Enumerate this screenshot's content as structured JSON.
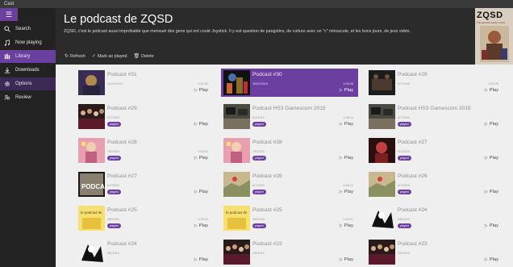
{
  "window": {
    "title": "Cast"
  },
  "sidebar": {
    "items": [
      {
        "label": "Search",
        "icon": "search-icon"
      },
      {
        "label": "Now playing",
        "icon": "music-note-icon"
      },
      {
        "label": "Library",
        "icon": "library-icon",
        "active": true
      },
      {
        "label": "Downloads",
        "icon": "download-icon"
      },
      {
        "label": "Options",
        "icon": "gear-icon"
      },
      {
        "label": "Review",
        "icon": "people-icon"
      }
    ]
  },
  "header": {
    "title": "Le podcast de ZQSD",
    "description": "ZQSD, c'est le podcast aussi improbable que mensuel des gens qui ont coulé Joystick. Il y est question de pangolins, de culture avec un \"c\" minuscule, et les bons jours, de jeux vidéo.",
    "cover_text": "ZQSD",
    "cover_tagline": "The genuine wacky sound"
  },
  "toolbar": {
    "refresh": "Refresh",
    "mark_played": "Mark as played",
    "delete": "Delete"
  },
  "episodes": [
    {
      "title": "Podcast #31",
      "date": "11/20/2015",
      "duration": "2:01:52",
      "badge": "",
      "play": "Play",
      "thumb": "purple"
    },
    {
      "title": "Podcast #30",
      "date": "10/20/2015",
      "duration": "2:06:26",
      "badge": "",
      "play": "Play",
      "thumb": "dark-scene",
      "selected": true
    },
    {
      "title": "Podcast #29",
      "date": "9/7/2015",
      "duration": "1:57:46",
      "badge": "",
      "play": "Play",
      "thumb": "dark-room"
    },
    {
      "title": "Podcast #29",
      "date": "9/7/2015",
      "duration": "",
      "badge": "played",
      "play": "Play",
      "thumb": "crowd"
    },
    {
      "title": "Podcast HS3 Gamescom 2015",
      "date": "8/7/2015",
      "duration": "1:08:11",
      "badge": "played",
      "play": "Play",
      "thumb": "desk"
    },
    {
      "title": "Podcast HS3 Gamescom 2015",
      "date": "8/7/2015",
      "duration": "",
      "badge": "played",
      "play": "Play",
      "thumb": "desk"
    },
    {
      "title": "Podcast #28",
      "date": "7/6/2015",
      "duration": "2:02:34",
      "badge": "played",
      "play": "Play",
      "thumb": "pink"
    },
    {
      "title": "Podcast #28",
      "date": "7/6/2015",
      "duration": "",
      "badge": "played",
      "play": "Play",
      "thumb": "pink"
    },
    {
      "title": "Podcast #27",
      "date": "6/7/2015",
      "duration": "",
      "badge": "played",
      "play": "Play",
      "thumb": "red"
    },
    {
      "title": "Podcast #27",
      "date": "6/7/2015",
      "duration": "",
      "badge": "played",
      "play": "Play",
      "thumb": "poster"
    },
    {
      "title": "Podcast #26",
      "date": "5/7/2015",
      "duration": "1:58:12",
      "badge": "played",
      "play": "Play",
      "thumb": "map"
    },
    {
      "title": "Podcast #26",
      "date": "5/7/2015",
      "duration": "",
      "badge": "played",
      "play": "Play",
      "thumb": "map"
    },
    {
      "title": "Podcast #25",
      "date": "4/5/2015",
      "duration": "2:26:31",
      "badge": "played",
      "play": "Play",
      "thumb": "yellow"
    },
    {
      "title": "Podcast #25",
      "date": "4/5/2015",
      "duration": "2:26:31",
      "badge": "played",
      "play": "Play",
      "thumb": "yellow"
    },
    {
      "title": "Podcast #24",
      "date": "3/5/2015",
      "duration": "",
      "badge": "played",
      "play": "Play",
      "thumb": "bw"
    },
    {
      "title": "Podcast #24",
      "date": "3/5/2015",
      "duration": "",
      "badge": "",
      "play": "Play",
      "thumb": "bw"
    },
    {
      "title": "Podcast #23",
      "date": "2/5/2015",
      "duration": "",
      "badge": "",
      "play": "Play",
      "thumb": "crowd"
    },
    {
      "title": "Podcast #23",
      "date": "2/5/2015",
      "duration": "",
      "badge": "",
      "play": "Play",
      "thumb": "crowd"
    }
  ],
  "colors": {
    "accent": "#6b3fa0",
    "sidebar": "#222222",
    "header": "#2b2b2b",
    "content": "#efefef"
  }
}
